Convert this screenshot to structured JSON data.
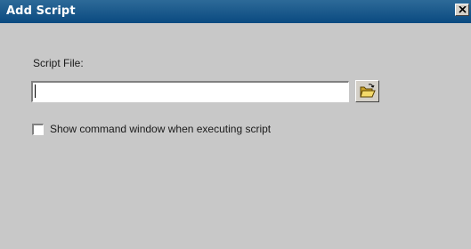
{
  "window": {
    "title": "Add Script"
  },
  "form": {
    "script_file_label": "Script File:",
    "script_file_value": "",
    "show_command_window_label": "Show command window when executing script",
    "show_command_window_checked": false
  },
  "icons": {
    "close": "close-icon",
    "browse": "open-folder-icon"
  },
  "colors": {
    "titlebar": "#0a4a80",
    "background": "#c8c8c8",
    "folder": "#e8c94a"
  }
}
